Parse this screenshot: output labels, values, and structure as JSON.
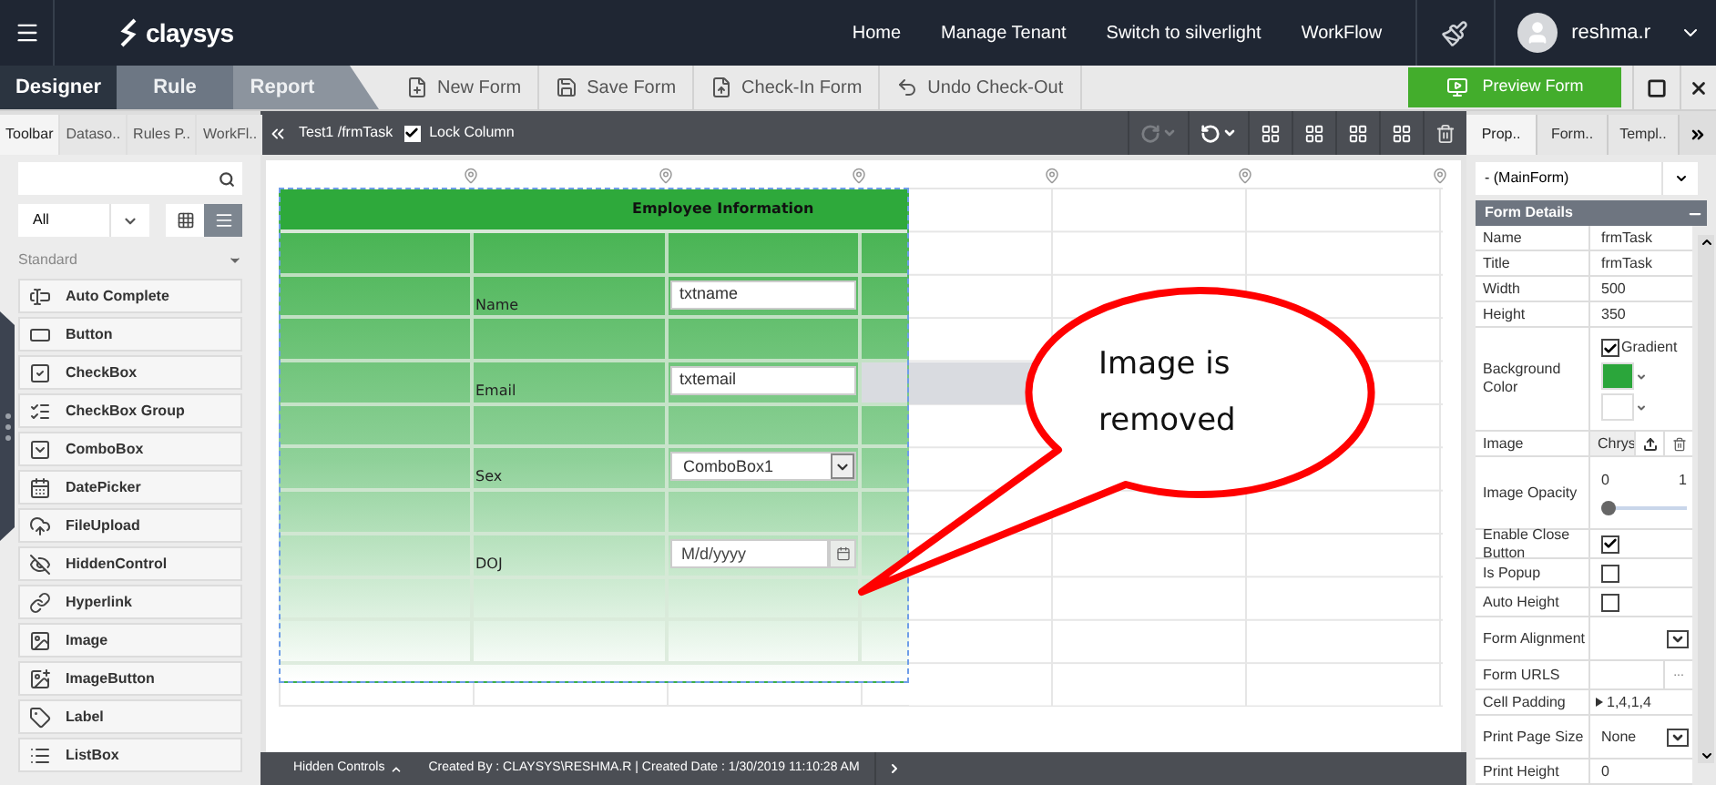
{
  "header": {
    "logo": "claysys",
    "nav": [
      "Home",
      "Manage Tenant",
      "Switch to silverlight",
      "WorkFlow"
    ],
    "user": "reshma.r"
  },
  "mode_tabs": [
    {
      "label": "Designer",
      "selected": true
    },
    {
      "label": "Rule",
      "selected": false
    },
    {
      "label": "Report",
      "selected": false
    }
  ],
  "toolbar": [
    {
      "kind": "new",
      "label": "New Form"
    },
    {
      "kind": "save",
      "label": "Save Form"
    },
    {
      "kind": "checkin",
      "label": "Check-In Form"
    },
    {
      "kind": "undo",
      "label": "Undo Check-Out"
    }
  ],
  "preview_button": "Preview Form",
  "left_panel": {
    "tabs": [
      {
        "label": "Toolbar",
        "selected": true
      },
      {
        "label": "Dataso..",
        "selected": false
      },
      {
        "label": "Rules P..",
        "selected": false
      },
      {
        "label": "WorkFl..",
        "selected": false
      }
    ],
    "filter": "All",
    "view_modes": [
      {
        "kind": "grid",
        "selected": false
      },
      {
        "kind": "list",
        "selected": true
      }
    ],
    "group": "Standard",
    "controls": [
      "Auto Complete",
      "Button",
      "CheckBox",
      "CheckBox Group",
      "ComboBox",
      "DatePicker",
      "FileUpload",
      "HiddenControl",
      "Hyperlink",
      "Image",
      "ImageButton",
      "Label",
      "ListBox"
    ]
  },
  "designer": {
    "breadcrumb": "Test1 /frmTask",
    "lock_column": {
      "label": "Lock Column",
      "checked": true
    },
    "actions": [
      {
        "kind": "redo",
        "disabled": true
      },
      {
        "kind": "undo",
        "disabled": false
      }
    ],
    "form": {
      "title": "Employee Information",
      "rows": [
        {
          "highlighted": false
        },
        {
          "label": "Name",
          "field": {
            "kind": "text",
            "value": "txtname"
          },
          "highlighted": false
        },
        {
          "highlighted": false
        },
        {
          "label": "Email",
          "field": {
            "kind": "text",
            "value": "txtemail"
          },
          "highlighted": true
        },
        {
          "highlighted": false
        },
        {
          "label": "Sex",
          "field": {
            "kind": "combo",
            "value": "ComboBox1"
          },
          "highlighted": false
        },
        {
          "highlighted": false
        },
        {
          "label": "DOJ",
          "field": {
            "kind": "date",
            "placeholder": "M/d/yyyy"
          },
          "highlighted": false
        },
        {
          "highlighted": false
        },
        {
          "highlighted": false
        }
      ]
    },
    "callout": "Image is removed",
    "status": {
      "hidden_controls": "Hidden Controls",
      "info": "Created By : CLAYSYS\\RESHMA.R | Created Date : 1/30/2019 11:10:28 AM"
    }
  },
  "right_panel": {
    "tabs": [
      {
        "label": "Prop..",
        "selected": true
      },
      {
        "label": "Form..",
        "selected": false
      },
      {
        "label": "Templ..",
        "selected": false
      }
    ],
    "object": "- (MainForm)",
    "section": "Form Details",
    "properties": [
      {
        "kind": "text",
        "name": "Name",
        "value": "frmTask"
      },
      {
        "kind": "text",
        "name": "Title",
        "value": "frmTask"
      },
      {
        "kind": "text",
        "name": "Width",
        "value": "500"
      },
      {
        "kind": "text",
        "name": "Height",
        "value": "350"
      },
      {
        "kind": "colors",
        "name": "Background Color",
        "gradient": {
          "label": "Gradient",
          "checked": true
        },
        "swatches": [
          {
            "color": "#2ba63b"
          },
          {
            "color": "#ffffff"
          }
        ]
      },
      {
        "kind": "image",
        "name": "Image",
        "value": "Chrys"
      },
      {
        "kind": "slider",
        "name": "Image Opacity",
        "min": "0",
        "max": "1",
        "level": 0
      },
      {
        "kind": "check",
        "name": "Enable Close Button",
        "checked": true
      },
      {
        "kind": "check",
        "name": "Is Popup",
        "checked": false
      },
      {
        "kind": "check",
        "name": "Auto Height",
        "checked": false
      },
      {
        "kind": "select",
        "name": "Form Alignment"
      },
      {
        "kind": "browse",
        "name": "Form URLS",
        "button": "..."
      },
      {
        "kind": "expand",
        "name": "Cell Padding",
        "value": "1,4,1,4"
      },
      {
        "kind": "select",
        "name": "Print Page Size",
        "value": "None"
      },
      {
        "kind": "text",
        "name": "Print Height",
        "value": "0"
      }
    ]
  }
}
